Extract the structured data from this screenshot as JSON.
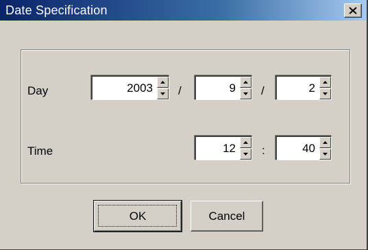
{
  "window": {
    "title": "Date Specification",
    "close_icon": "close-icon"
  },
  "day": {
    "label": "Day",
    "year": "2003",
    "month": "9",
    "date": "2",
    "separator": "/"
  },
  "time": {
    "label": "Time",
    "hour": "12",
    "minute": "40",
    "separator": ":"
  },
  "buttons": {
    "ok": "OK",
    "cancel": "Cancel"
  }
}
